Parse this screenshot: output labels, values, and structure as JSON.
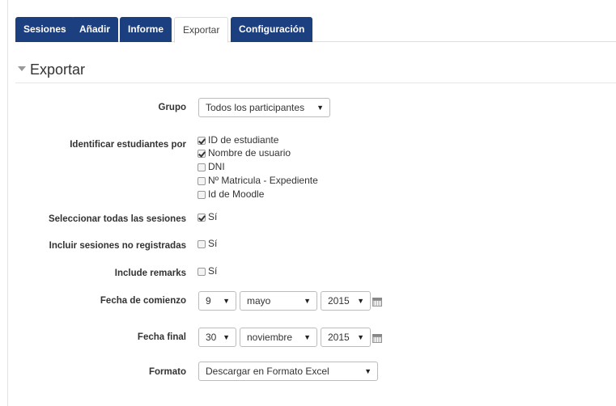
{
  "tabs": [
    {
      "label": "Sesiones",
      "active": false
    },
    {
      "label": "Añadir",
      "active": false
    },
    {
      "label": "Informe",
      "active": false
    },
    {
      "label": "Exportar",
      "active": true
    },
    {
      "label": "Configuración",
      "active": false
    }
  ],
  "section": {
    "title": "Exportar"
  },
  "form": {
    "grupo": {
      "label": "Grupo",
      "value": "Todos los participantes"
    },
    "identificar": {
      "label": "Identificar estudiantes por",
      "options": [
        {
          "label": "ID de estudiante",
          "checked": true
        },
        {
          "label": "Nombre de usuario",
          "checked": true
        },
        {
          "label": "DNI",
          "checked": false
        },
        {
          "label": "Nº Matricula - Expediente",
          "checked": false
        },
        {
          "label": "Id de Moodle",
          "checked": false
        }
      ]
    },
    "seleccionar": {
      "label": "Seleccionar todas las sesiones",
      "option": "Sí",
      "checked": true
    },
    "incluir": {
      "label": "Incluir sesiones no registradas",
      "option": "Sí",
      "checked": false
    },
    "remarks": {
      "label": "Include remarks",
      "option": "Sí",
      "checked": false
    },
    "fecha_comienzo": {
      "label": "Fecha de comienzo",
      "day": "9",
      "month": "mayo",
      "year": "2015"
    },
    "fecha_final": {
      "label": "Fecha final",
      "day": "30",
      "month": "noviembre",
      "year": "2015"
    },
    "formato": {
      "label": "Formato",
      "value": "Descargar en Formato Excel"
    }
  },
  "colors": {
    "tab_dark": "#1c3f80",
    "text": "#333333"
  },
  "icons": {
    "dropdown": "▼",
    "section_caret": "caret-down",
    "calendar": "calendar-icon"
  }
}
